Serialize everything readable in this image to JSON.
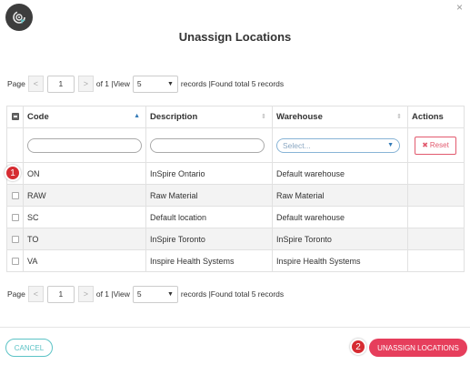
{
  "dialog": {
    "title": "Unassign Locations",
    "close": "×"
  },
  "pager_top": {
    "page_label": "Page",
    "prev": "<",
    "page_value": "1",
    "next": ">",
    "of_text": "of 1 |View",
    "view_value": "5",
    "records_text": "records |Found total 5 records"
  },
  "pager_bottom": {
    "page_label": "Page",
    "prev": "<",
    "page_value": "1",
    "next": ">",
    "of_text": "of 1 |View",
    "view_value": "5",
    "records_text": "records |Found total 5 records"
  },
  "table": {
    "headers": {
      "code": "Code",
      "description": "Description",
      "warehouse": "Warehouse",
      "actions": "Actions"
    },
    "filter": {
      "code_value": "",
      "description_value": "",
      "warehouse_placeholder": "Select...",
      "reset_label": "Reset"
    },
    "rows": [
      {
        "code": "ON",
        "description": "InSpire Ontario",
        "warehouse": "Default warehouse"
      },
      {
        "code": "RAW",
        "description": "Raw Material",
        "warehouse": "Raw Material"
      },
      {
        "code": "SC",
        "description": "Default location",
        "warehouse": "Default warehouse"
      },
      {
        "code": "TO",
        "description": "InSpire Toronto",
        "warehouse": "InSpire Toronto"
      },
      {
        "code": "VA",
        "description": "Inspire Health Systems",
        "warehouse": "Inspire Health Systems"
      }
    ]
  },
  "footer": {
    "cancel_label": "CANCEL",
    "unassign_label": "UNASSIGN LOCATIONS"
  },
  "steps": {
    "one": "1",
    "two": "2"
  },
  "colors": {
    "accent": "#e63e5c",
    "secondary": "#5cc3c6",
    "step_badge": "#d62c32"
  }
}
